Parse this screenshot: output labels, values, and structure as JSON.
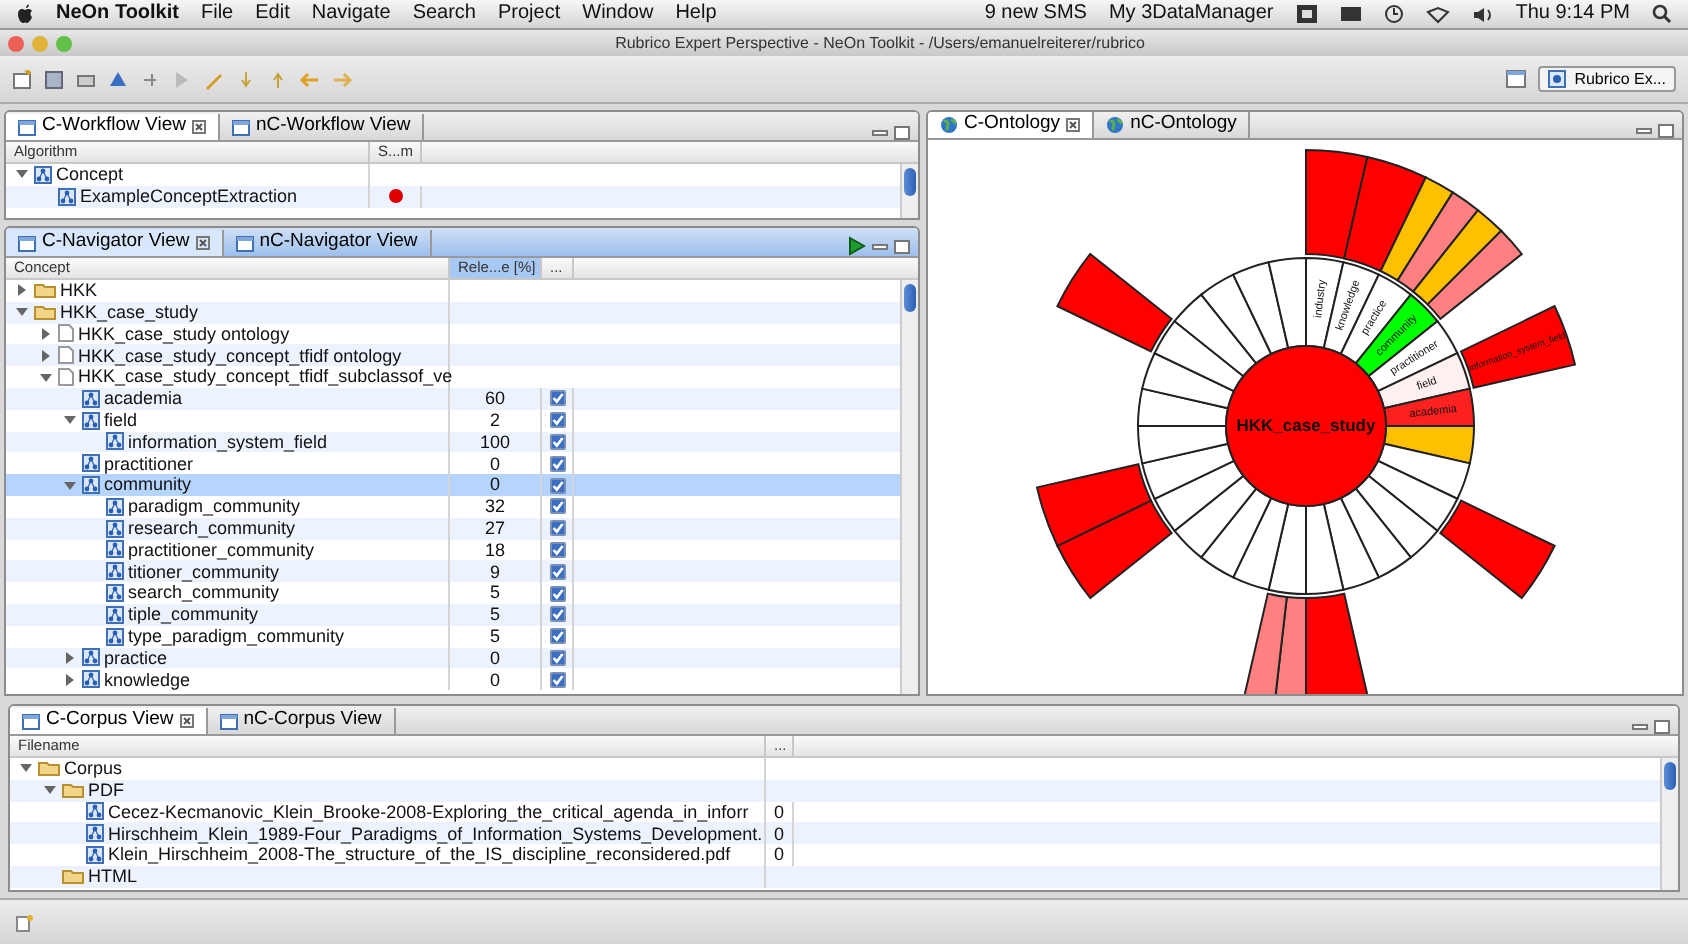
{
  "menu_bar": {
    "app": "NeOn Toolkit",
    "items": [
      "File",
      "Edit",
      "Navigate",
      "Search",
      "Project",
      "Window",
      "Help"
    ],
    "status_items": [
      "9 new SMS",
      "My 3DataManager"
    ],
    "clock": "Thu 9:14 PM"
  },
  "window": {
    "title": "Rubrico Expert Perspective - NeOn Toolkit - /Users/emanuelreiterer/rubrico"
  },
  "toolbar": {
    "perspective": "Rubrico Ex..."
  },
  "workflow_view": {
    "focused": false,
    "tabs": [
      {
        "label": "C-Workflow View",
        "selected": true
      },
      {
        "label": "nC-Workflow View",
        "selected": false
      }
    ],
    "columns": [
      "Algorithm",
      "S...m"
    ],
    "tree": [
      {
        "label": "Concept",
        "kind": "concept",
        "expanded": true,
        "children": [
          {
            "label": "ExampleConceptExtraction",
            "kind": "concept",
            "color": "#e00000"
          }
        ]
      }
    ]
  },
  "navigator_view": {
    "focused": true,
    "tabs": [
      {
        "label": "C-Navigator View",
        "selected": true
      },
      {
        "label": "nC-Navigator View",
        "selected": false
      }
    ],
    "columns": [
      "Concept",
      "Rele...e [%]",
      "..."
    ],
    "tree": [
      {
        "label": "HKK",
        "kind": "folder",
        "expanded": false
      },
      {
        "label": "HKK_case_study",
        "kind": "folder",
        "expanded": true,
        "children": [
          {
            "label": "HKK_case_study ontology",
            "kind": "file",
            "expanded": false
          },
          {
            "label": "HKK_case_study_concept_tfidf ontology",
            "kind": "file",
            "expanded": false
          },
          {
            "label": "HKK_case_study_concept_tfidf_subclassof_ve",
            "kind": "file",
            "expanded": true,
            "children": [
              {
                "label": "academia",
                "kind": "concept",
                "value": "60",
                "checked": true,
                "selected": false
              },
              {
                "label": "field",
                "kind": "concept",
                "value": "2",
                "checked": true,
                "selected": false,
                "expanded": true,
                "children": [
                  {
                    "label": "information_system_field",
                    "kind": "concept",
                    "value": "100",
                    "checked": true,
                    "selected": false
                  }
                ]
              },
              {
                "label": "practitioner",
                "kind": "concept",
                "value": "0",
                "checked": true,
                "selected": false
              },
              {
                "label": "community",
                "kind": "concept",
                "value": "0",
                "checked": true,
                "selected": true,
                "expanded": true,
                "children": [
                  {
                    "label": "paradigm_community",
                    "kind": "concept",
                    "value": "32",
                    "checked": true,
                    "selected": false
                  },
                  {
                    "label": "research_community",
                    "kind": "concept",
                    "value": "27",
                    "checked": true,
                    "selected": false
                  },
                  {
                    "label": "practitioner_community",
                    "kind": "concept",
                    "value": "18",
                    "checked": true,
                    "selected": false
                  },
                  {
                    "label": "titioner_community",
                    "kind": "concept",
                    "value": "9",
                    "checked": true,
                    "selected": false
                  },
                  {
                    "label": "search_community",
                    "kind": "concept",
                    "value": "5",
                    "checked": true,
                    "selected": false
                  },
                  {
                    "label": "tiple_community",
                    "kind": "concept",
                    "value": "5",
                    "checked": true,
                    "selected": false
                  },
                  {
                    "label": "type_paradigm_community",
                    "kind": "concept",
                    "value": "5",
                    "checked": true,
                    "selected": false
                  }
                ]
              },
              {
                "label": "practice",
                "kind": "concept",
                "value": "0",
                "checked": true,
                "selected": false,
                "expanded": false
              },
              {
                "label": "knowledge",
                "kind": "concept",
                "value": "0",
                "checked": true,
                "selected": false,
                "expanded": false
              }
            ]
          }
        ]
      }
    ]
  },
  "ontology_view": {
    "tabs": [
      {
        "label": "C-Ontology",
        "selected": true
      },
      {
        "label": "nC-Ontology",
        "selected": false
      }
    ],
    "sunburst": {
      "center_label": "HKK_case_study",
      "segments": [
        {
          "label": "industry",
          "color": "#ffffff",
          "children": [
            {
              "color": "#ff0000"
            }
          ]
        },
        {
          "label": "knowledge",
          "color": "#ffffff",
          "children": [
            {
              "color": "#ff0000"
            }
          ]
        },
        {
          "label": "practice",
          "color": "#ffffff",
          "children": [
            {
              "color": "#ffc000"
            },
            {
              "color": "#ff8080"
            }
          ]
        },
        {
          "label": "community",
          "color": "#00ff00",
          "children": [
            {
              "color": "#ffc000"
            },
            {
              "color": "#ff8080"
            }
          ]
        },
        {
          "label": "practitioner",
          "color": "#ffffff"
        },
        {
          "label": "field",
          "color": "#fff0f0",
          "children": [
            {
              "label": "information_system_field",
              "color": "#ff0000"
            }
          ]
        },
        {
          "label": "academia",
          "color": "#ff2020"
        },
        {
          "color": "#ffc000"
        },
        {
          "color": "#ffffff"
        },
        {
          "color": "#ffffff",
          "children": [
            {
              "color": "#ff0000"
            }
          ]
        },
        {
          "color": "#ffffff"
        },
        {
          "color": "#ffffff"
        },
        {
          "color": "#ffffff"
        },
        {
          "color": "#ffffff",
          "children": [
            {
              "color": "#ff0000"
            }
          ]
        },
        {
          "color": "#ffffff",
          "children": [
            {
              "color": "#ff8080"
            },
            {
              "color": "#ff8080"
            }
          ]
        },
        {
          "color": "#ffffff"
        },
        {
          "color": "#ffffff"
        },
        {
          "color": "#ffffff"
        },
        {
          "color": "#ffffff",
          "children": [
            {
              "color": "#ff0000"
            }
          ]
        },
        {
          "color": "#ffffff",
          "children": [
            {
              "color": "#ff0000"
            }
          ]
        },
        {
          "color": "#ffffff"
        },
        {
          "color": "#ffffff"
        },
        {
          "color": "#ffffff"
        },
        {
          "color": "#ffffff",
          "children": [
            {
              "color": "#ff0000"
            }
          ]
        },
        {
          "color": "#ffffff"
        },
        {
          "color": "#ffffff"
        },
        {
          "color": "#ffffff"
        },
        {
          "color": "#ffffff"
        }
      ]
    }
  },
  "corpus_view": {
    "focused": false,
    "tabs": [
      {
        "label": "C-Corpus View",
        "selected": true
      },
      {
        "label": "nC-Corpus View",
        "selected": false
      }
    ],
    "columns": [
      "Filename",
      "..."
    ],
    "tree": [
      {
        "label": "Corpus",
        "kind": "folder",
        "expanded": true,
        "children": [
          {
            "label": "PDF",
            "kind": "folder",
            "expanded": true,
            "children": [
              {
                "label": "Cecez-Kecmanovic_Klein_Brooke-2008-Exploring_the_critical_agenda_in_inforr",
                "kind": "concept",
                "value": "0"
              },
              {
                "label": "Hirschheim_Klein_1989-Four_Paradigms_of_Information_Systems_Development.",
                "kind": "concept",
                "value": "0"
              },
              {
                "label": "Klein_Hirschheim_2008-The_structure_of_the_IS_discipline_reconsidered.pdf",
                "kind": "concept",
                "value": "0"
              }
            ]
          },
          {
            "label": "HTML",
            "kind": "folder"
          }
        ]
      }
    ]
  }
}
